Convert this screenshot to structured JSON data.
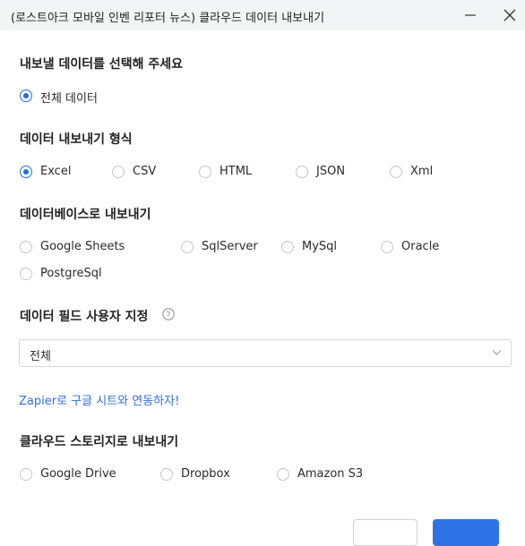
{
  "window": {
    "title": "(로스트아크 모바일 인벤 리포터 뉴스) 클라우드 데이터 내보내기"
  },
  "section_select": {
    "heading": "내보낼 데이터를 선택해 주세요",
    "options": [
      {
        "label": "전체 데이터",
        "checked": true
      }
    ]
  },
  "section_format": {
    "heading": "데이터 내보내기 형식",
    "options": [
      {
        "label": "Excel",
        "checked": true
      },
      {
        "label": "CSV",
        "checked": false
      },
      {
        "label": "HTML",
        "checked": false
      },
      {
        "label": "JSON",
        "checked": false
      },
      {
        "label": "Xml",
        "checked": false
      }
    ]
  },
  "section_database": {
    "heading": "데이터베이스로 내보내기",
    "options": [
      {
        "label": "Google Sheets",
        "checked": false
      },
      {
        "label": "SqlServer",
        "checked": false
      },
      {
        "label": "MySql",
        "checked": false
      },
      {
        "label": "Oracle",
        "checked": false
      },
      {
        "label": "PostgreSql",
        "checked": false
      }
    ]
  },
  "section_fields": {
    "heading": "데이터 필드 사용자 지정",
    "select_value": "전체"
  },
  "zapier_link": "Zapier로 구글 시트와 연동하자!",
  "section_cloud": {
    "heading": "클라우드 스토리지로 내보내기",
    "options": [
      {
        "label": "Google Drive",
        "checked": false
      },
      {
        "label": "Dropbox",
        "checked": false
      },
      {
        "label": "Amazon S3",
        "checked": false
      }
    ]
  },
  "colors": {
    "accent": "#1e6fe8",
    "link": "#2f6fde",
    "titlebar_bg": "#f3f4f6"
  }
}
